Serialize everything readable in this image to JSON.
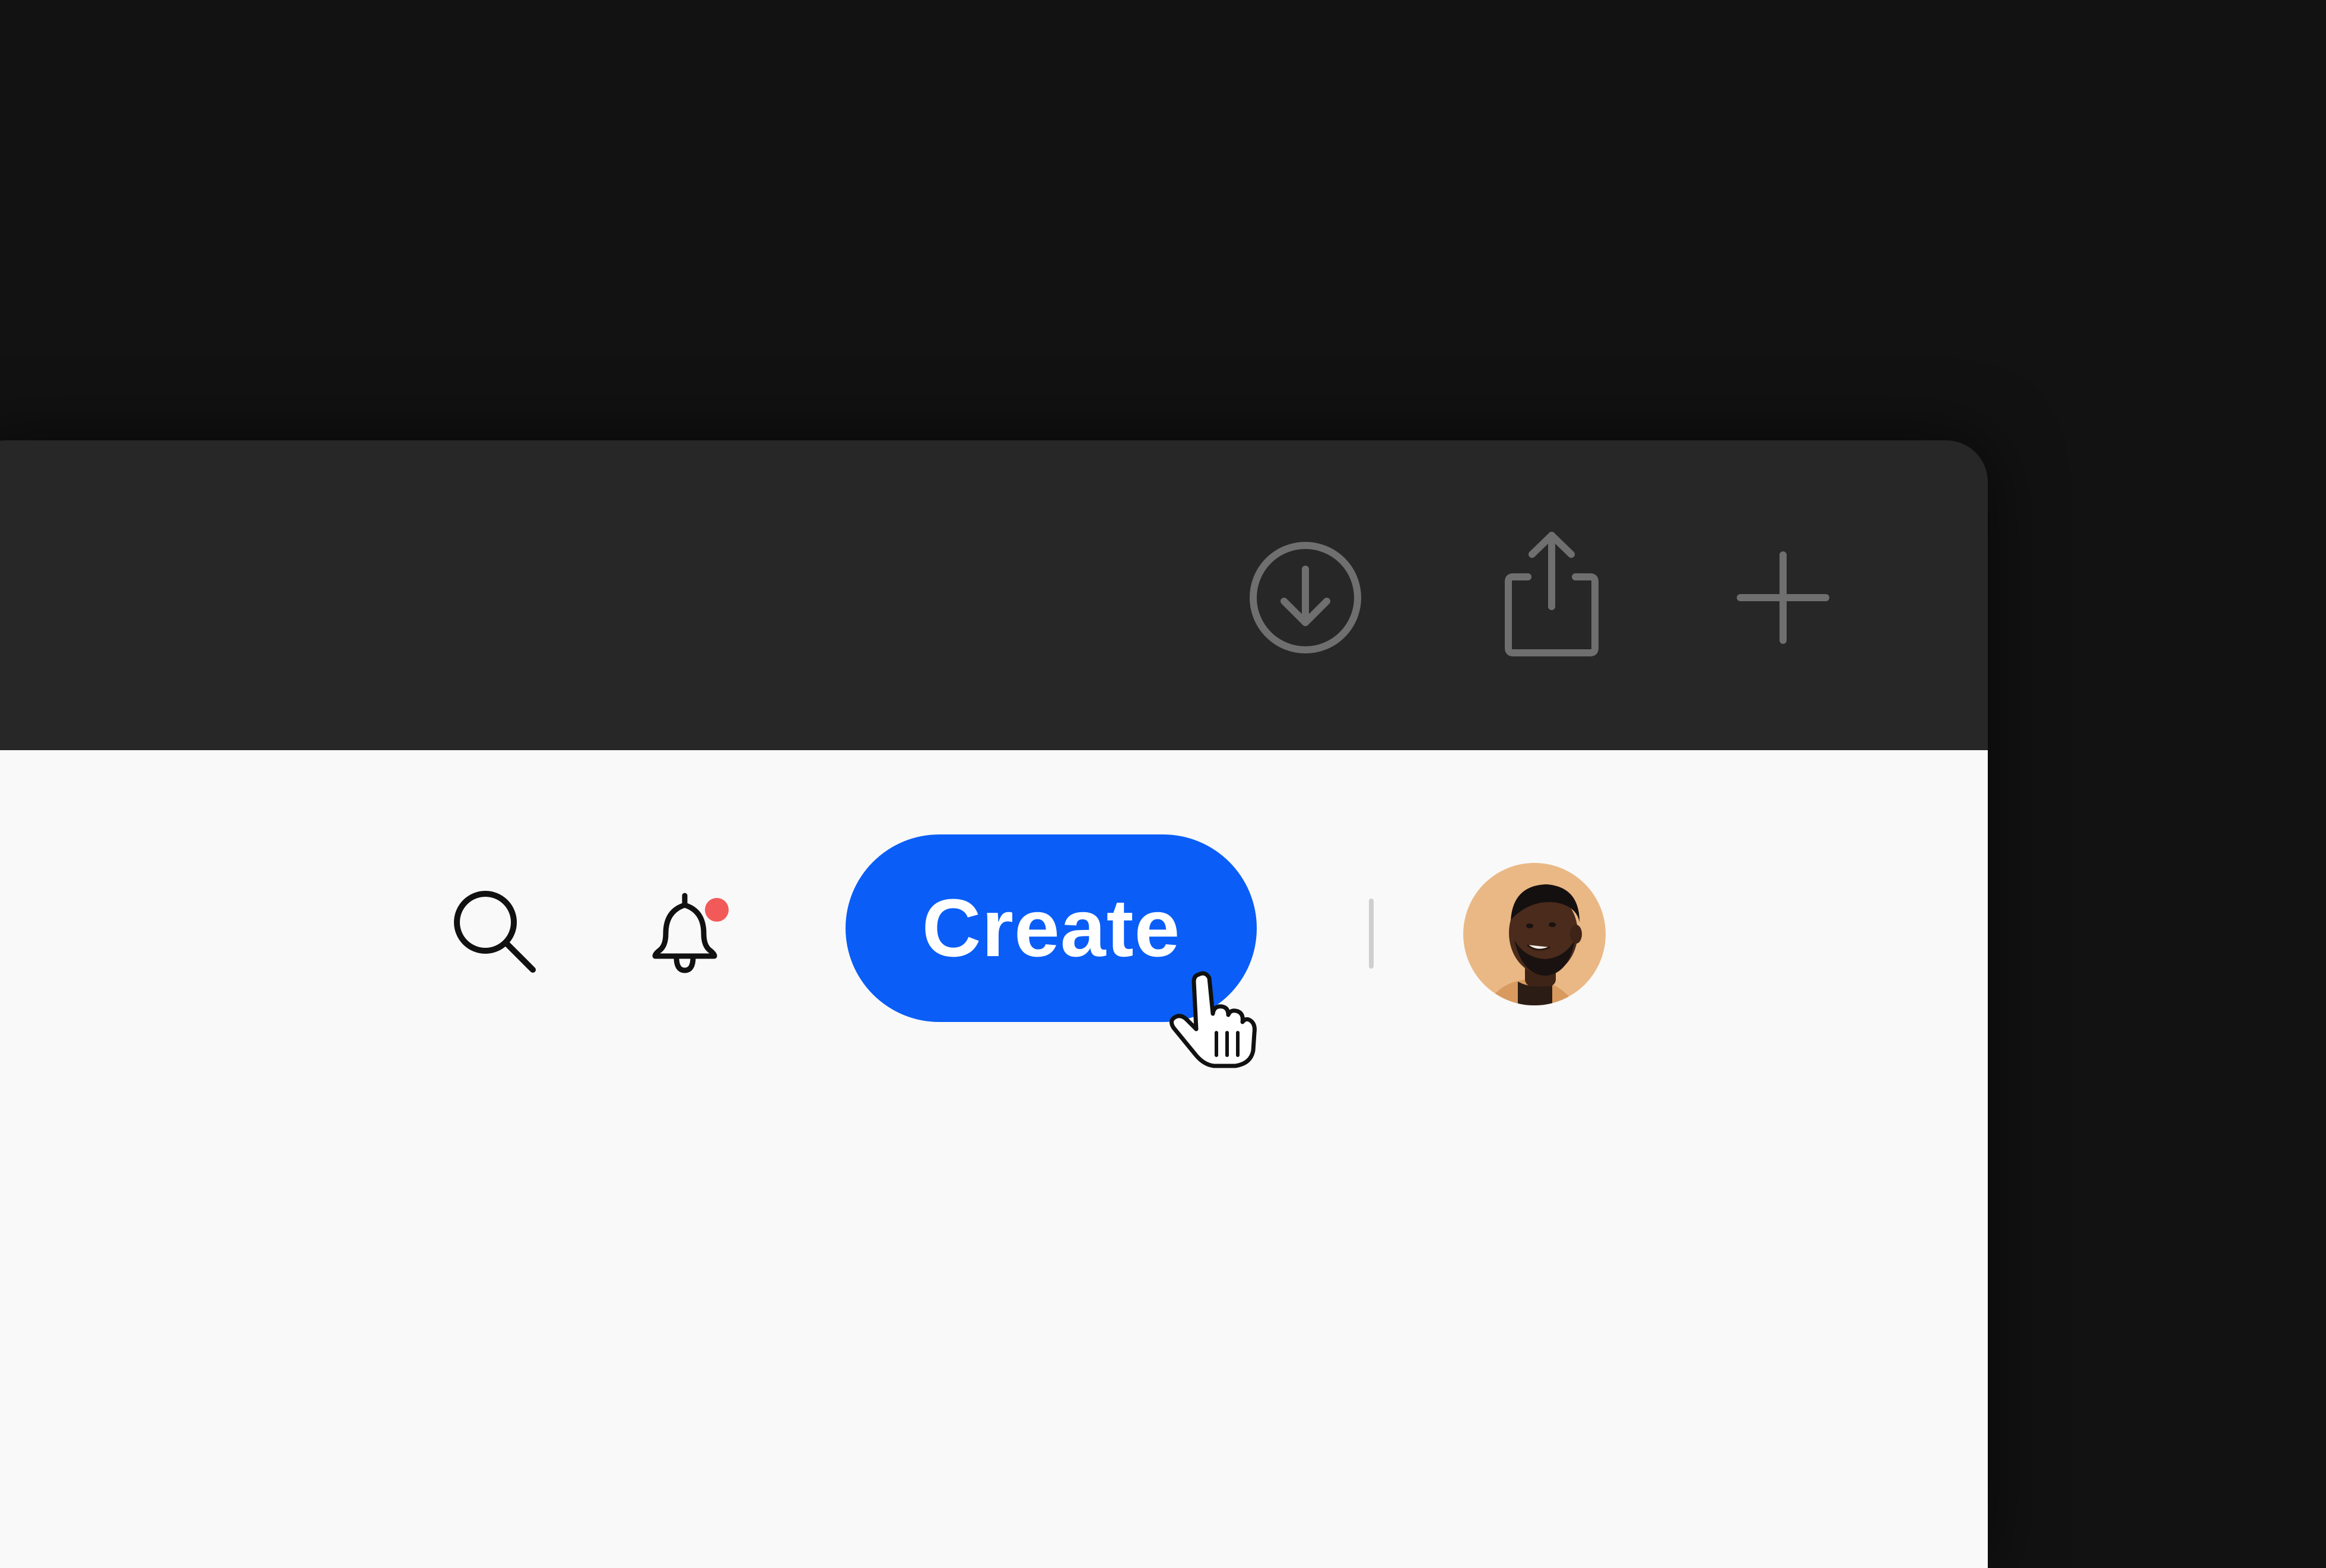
{
  "toolbar": {
    "icons": [
      "download-icon",
      "share-icon",
      "plus-icon"
    ]
  },
  "header": {
    "icons": [
      "search-icon",
      "bell-icon"
    ],
    "notification_dot_color": "#f25a5a",
    "create_label": "Create",
    "accent_color": "#0a5ef7"
  },
  "user": {
    "avatar": "user-avatar"
  }
}
